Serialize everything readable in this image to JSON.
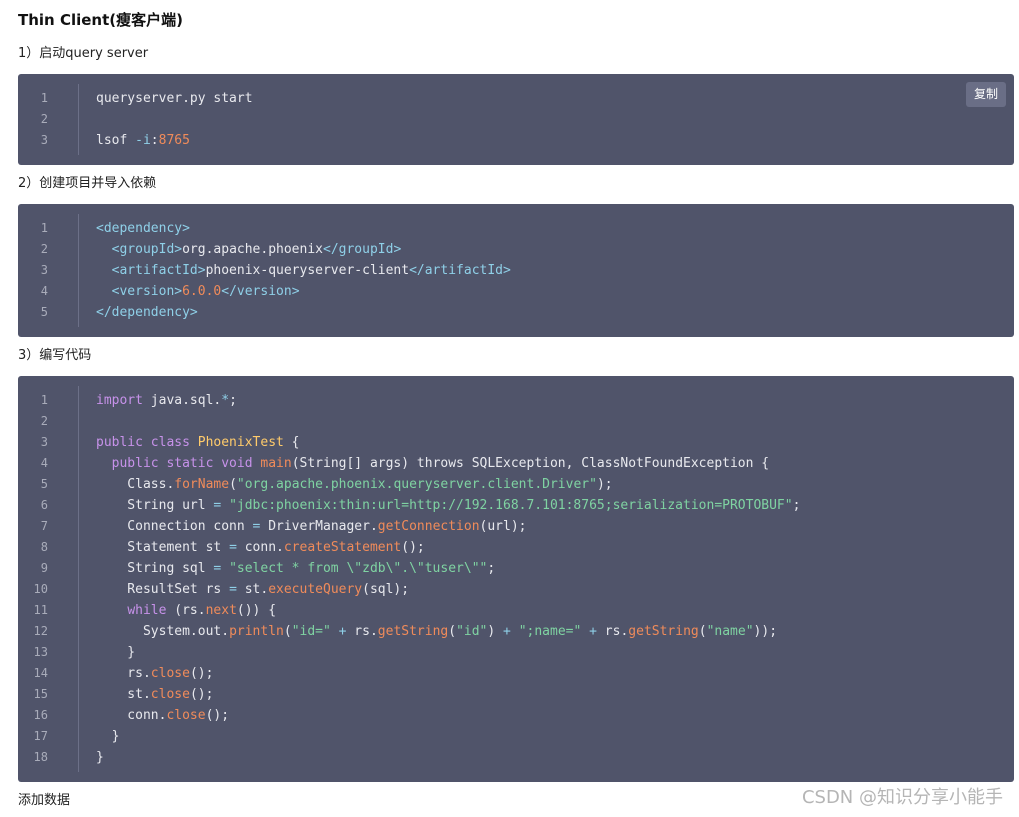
{
  "article": {
    "heading": "Thin Client(瘦客户端)",
    "para1": "1）启动query server",
    "para2": "2）创建项目并导入依赖",
    "para3": "3）编写代码",
    "footer": "添加数据"
  },
  "copy_button_label": "复制",
  "watermark": "CSDN @知识分享小能手",
  "colors": {
    "code_background": "#50546a",
    "copy_button": "#6a6e86",
    "xml_tag": "#8fd0e8",
    "string": "#7fd3a2",
    "number_and_method": "#f08b5a",
    "keyword": "#c792ea",
    "class_name": "#ffcb6b"
  },
  "code_blocks": [
    {
      "lines": [
        [
          {
            "t": "plain",
            "v": "queryserver.py start"
          }
        ],
        [],
        [
          {
            "t": "plain",
            "v": "lsof "
          },
          {
            "t": "operator",
            "v": "-i"
          },
          {
            "t": "plain",
            "v": ":"
          },
          {
            "t": "number",
            "v": "8765"
          }
        ]
      ]
    },
    {
      "lines": [
        [
          {
            "t": "tag",
            "v": "<dependency>"
          }
        ],
        [
          {
            "t": "plain",
            "v": "  "
          },
          {
            "t": "tag",
            "v": "<groupId>"
          },
          {
            "t": "plain",
            "v": "org.apache.phoenix"
          },
          {
            "t": "tag",
            "v": "</groupId>"
          }
        ],
        [
          {
            "t": "plain",
            "v": "  "
          },
          {
            "t": "tag",
            "v": "<artifactId>"
          },
          {
            "t": "plain",
            "v": "phoenix-queryserver-client"
          },
          {
            "t": "tag",
            "v": "</artifactId>"
          }
        ],
        [
          {
            "t": "plain",
            "v": "  "
          },
          {
            "t": "tag",
            "v": "<version>"
          },
          {
            "t": "number",
            "v": "6.0.0"
          },
          {
            "t": "tag",
            "v": "</version>"
          }
        ],
        [
          {
            "t": "tag",
            "v": "</dependency>"
          }
        ]
      ]
    },
    {
      "lines": [
        [
          {
            "t": "keyword",
            "v": "import"
          },
          {
            "t": "plain",
            "v": " java.sql."
          },
          {
            "t": "operator",
            "v": "*"
          },
          {
            "t": "plain",
            "v": ";"
          }
        ],
        [],
        [
          {
            "t": "keyword",
            "v": "public class"
          },
          {
            "t": "plain",
            "v": " "
          },
          {
            "t": "classname",
            "v": "PhoenixTest"
          },
          {
            "t": "plain",
            "v": " {"
          }
        ],
        [
          {
            "t": "plain",
            "v": "  "
          },
          {
            "t": "keyword",
            "v": "public static void"
          },
          {
            "t": "plain",
            "v": " "
          },
          {
            "t": "function",
            "v": "main"
          },
          {
            "t": "plain",
            "v": "(String[] args) throws SQLException, ClassNotFoundException {"
          }
        ],
        [
          {
            "t": "plain",
            "v": "    Class."
          },
          {
            "t": "function",
            "v": "forName"
          },
          {
            "t": "plain",
            "v": "("
          },
          {
            "t": "string",
            "v": "\"org.apache.phoenix.queryserver.client.Driver\""
          },
          {
            "t": "plain",
            "v": ");"
          }
        ],
        [
          {
            "t": "plain",
            "v": "    String url "
          },
          {
            "t": "operator",
            "v": "="
          },
          {
            "t": "plain",
            "v": " "
          },
          {
            "t": "string",
            "v": "\"jdbc:phoenix:thin:url=http://192.168.7.101:8765;serialization=PROTOBUF\""
          },
          {
            "t": "plain",
            "v": ";"
          }
        ],
        [
          {
            "t": "plain",
            "v": "    Connection conn "
          },
          {
            "t": "operator",
            "v": "="
          },
          {
            "t": "plain",
            "v": " DriverManager."
          },
          {
            "t": "function",
            "v": "getConnection"
          },
          {
            "t": "plain",
            "v": "(url);"
          }
        ],
        [
          {
            "t": "plain",
            "v": "    Statement st "
          },
          {
            "t": "operator",
            "v": "="
          },
          {
            "t": "plain",
            "v": " conn."
          },
          {
            "t": "function",
            "v": "createStatement"
          },
          {
            "t": "plain",
            "v": "();"
          }
        ],
        [
          {
            "t": "plain",
            "v": "    String sql "
          },
          {
            "t": "operator",
            "v": "="
          },
          {
            "t": "plain",
            "v": " "
          },
          {
            "t": "string",
            "v": "\"select * from \\\"zdb\\\".\\\"tuser\\\"\""
          },
          {
            "t": "plain",
            "v": ";"
          }
        ],
        [
          {
            "t": "plain",
            "v": "    ResultSet rs "
          },
          {
            "t": "operator",
            "v": "="
          },
          {
            "t": "plain",
            "v": " st."
          },
          {
            "t": "function",
            "v": "executeQuery"
          },
          {
            "t": "plain",
            "v": "(sql);"
          }
        ],
        [
          {
            "t": "plain",
            "v": "    "
          },
          {
            "t": "keyword",
            "v": "while"
          },
          {
            "t": "plain",
            "v": " (rs."
          },
          {
            "t": "function",
            "v": "next"
          },
          {
            "t": "plain",
            "v": "()) {"
          }
        ],
        [
          {
            "t": "plain",
            "v": "      System.out."
          },
          {
            "t": "function",
            "v": "println"
          },
          {
            "t": "plain",
            "v": "("
          },
          {
            "t": "string",
            "v": "\"id=\""
          },
          {
            "t": "plain",
            "v": " "
          },
          {
            "t": "operator",
            "v": "+"
          },
          {
            "t": "plain",
            "v": " rs."
          },
          {
            "t": "function",
            "v": "getString"
          },
          {
            "t": "plain",
            "v": "("
          },
          {
            "t": "string",
            "v": "\"id\""
          },
          {
            "t": "plain",
            "v": ") "
          },
          {
            "t": "operator",
            "v": "+"
          },
          {
            "t": "plain",
            "v": " "
          },
          {
            "t": "string",
            "v": "\";name=\""
          },
          {
            "t": "plain",
            "v": " "
          },
          {
            "t": "operator",
            "v": "+"
          },
          {
            "t": "plain",
            "v": " rs."
          },
          {
            "t": "function",
            "v": "getString"
          },
          {
            "t": "plain",
            "v": "("
          },
          {
            "t": "string",
            "v": "\"name\""
          },
          {
            "t": "plain",
            "v": "));"
          }
        ],
        [
          {
            "t": "plain",
            "v": "    }"
          }
        ],
        [
          {
            "t": "plain",
            "v": "    rs."
          },
          {
            "t": "function",
            "v": "close"
          },
          {
            "t": "plain",
            "v": "();"
          }
        ],
        [
          {
            "t": "plain",
            "v": "    st."
          },
          {
            "t": "function",
            "v": "close"
          },
          {
            "t": "plain",
            "v": "();"
          }
        ],
        [
          {
            "t": "plain",
            "v": "    conn."
          },
          {
            "t": "function",
            "v": "close"
          },
          {
            "t": "plain",
            "v": "();"
          }
        ],
        [
          {
            "t": "plain",
            "v": "  }"
          }
        ],
        [
          {
            "t": "plain",
            "v": "}"
          }
        ]
      ]
    }
  ]
}
